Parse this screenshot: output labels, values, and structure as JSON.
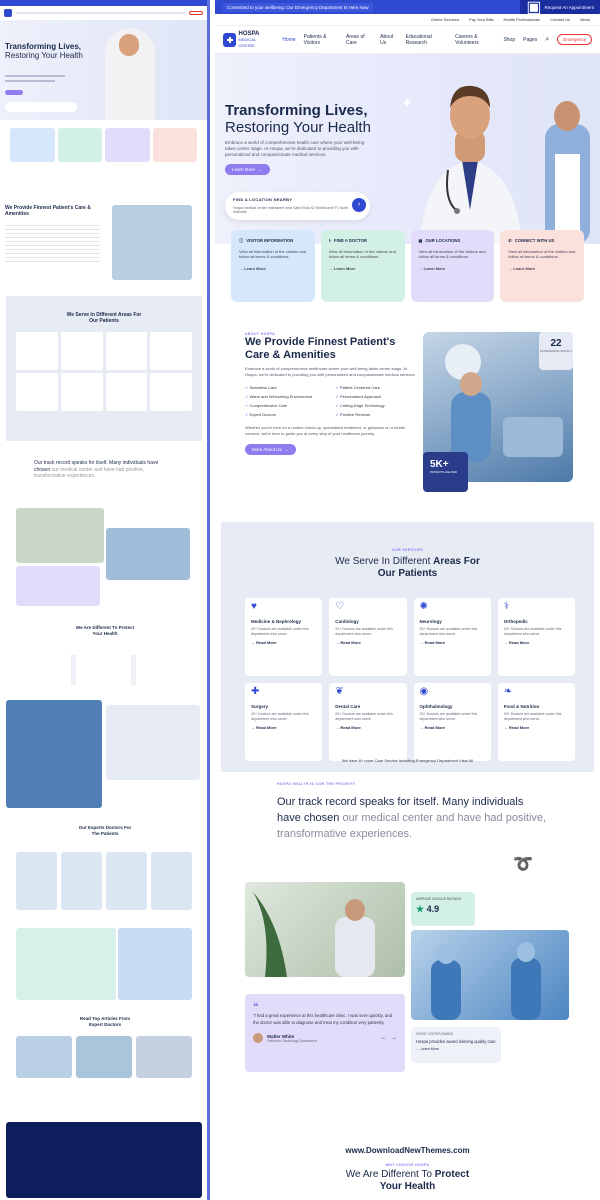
{
  "topbar": {
    "promo": "Committed to your wellbeing: Our Emergency Department Is Here Now",
    "links": [
      "Online Services",
      "Pay Your Bills",
      "Health Professionals",
      "Contact Us",
      "News"
    ],
    "appointment": "Request An Appointment"
  },
  "brand": {
    "name": "HOSPA",
    "sub1": "MEDICAL",
    "sub2": "CENTRE"
  },
  "nav": {
    "items": [
      "Home",
      "Patients & Visitors",
      "Areas of Care",
      "About Us",
      "Educational Research",
      "Careers & Volunteers",
      "Shop",
      "Pages"
    ],
    "emergency": "Emergency"
  },
  "hero": {
    "title1": "Transforming Lives,",
    "title2": "Restoring Your Health",
    "text": "Embrace a world of comprehensive health care where your well-being takes center stage. At Hospa, we're dedicated to providing you with personalized and compassionate medical services.",
    "button": "Learn More",
    "find_title": "FIND A LOCATION NEARBY",
    "find_value": "Hospa medical center mainstreet near Saint Kilda 52 Shelbourne Pl, North Adelaide"
  },
  "cards": [
    {
      "title": "VISITOR INFORMATION",
      "text": "View all information of the visitors and follow all terms & conditions.",
      "link": "Learn More",
      "color": "#d6e6fb"
    },
    {
      "title": "FIND A DOCTOR",
      "text": "View all information of the visitors and follow all terms & conditions.",
      "link": "Learn More",
      "color": "#d3f0e6"
    },
    {
      "title": "OUR LOCATIONS",
      "text": "View all information of the visitors and follow all terms & conditions.",
      "link": "Learn More",
      "color": "#e2dbfa"
    },
    {
      "title": "CONNECT WITH US",
      "text": "View all information of the visitors and follow all terms & conditions.",
      "link": "Learn More",
      "color": "#fbe1dc"
    }
  ],
  "about": {
    "kicker": "ABOUT HOSPA",
    "title1": "We Provide Finnest Patient's",
    "title2": "Care & Amenities",
    "text": "Embrace a world of comprehensive healthcare where your well-being takes center stage. At Hospa, we're dedicated to providing you with personalized and compassionate medical services.",
    "checks": [
      "Seamless Care",
      "Patient-Centered Care",
      "Warm and Welcoming Environment",
      "Personalized Approach",
      "Comprehensive Care",
      "Cutting-Edge Technology",
      "Expert Doctors",
      "Positive Reviews"
    ],
    "text2": "Whether you're here for a routine check-up, specialized treatment, or guidance on a health concern, we're here to guide you at every step of your healthcare journey.",
    "button": "More About Us",
    "years": "22",
    "years_label": "EXPERIENCE SINCE 3",
    "count": "5K+",
    "count_label": "PATIENTS HELPED"
  },
  "services": {
    "kicker": "OUR SERVICES",
    "title1": "We Serve In Different ",
    "title_bold": "Areas For",
    "title2": "Our Patients",
    "items": [
      {
        "name": "Medicine & Nephrology",
        "icon": "kidney-icon",
        "glyph": "♥"
      },
      {
        "name": "Cardiology",
        "icon": "heartbeat-icon",
        "glyph": "♡"
      },
      {
        "name": "Neurology",
        "icon": "brain-icon",
        "glyph": "✺"
      },
      {
        "name": "Orthopedic",
        "icon": "bone-icon",
        "glyph": "⚕"
      },
      {
        "name": "Surgery",
        "icon": "surgery-icon",
        "glyph": "✚"
      },
      {
        "name": "Dental Care",
        "icon": "tooth-icon",
        "glyph": "❦"
      },
      {
        "name": "Ophthalmology",
        "icon": "eye-icon",
        "glyph": "◉"
      },
      {
        "name": "Food & Nutrition",
        "icon": "nutrition-icon",
        "glyph": "❧"
      }
    ],
    "desc": "20+ Doctors are available under this department who serve.",
    "more": "Read More",
    "footer": "We have 8+ more Care Service including Emergency Department View All"
  },
  "track": {
    "kicker": "HOSPA HEALTH IS OUR THE PRIORITY",
    "q1": "Our track record speaks for itself. Many individuals have chosen ",
    "q2": "our medical center and have had positive, transformative experiences.",
    "rating_label": "AVERAGE GOOGLE RATINGS",
    "rating": "4.9",
    "review": "\"I had a great experience at this healthcare clinic. I was seen quickly, and the doctor was able to diagnose and treat my condition very patiently.",
    "reviewer": "Walter White",
    "reviewer_role": "Patient in Cardiology Department",
    "award_label": "GREAT CENTER AWARD",
    "award": "Hospa provides award winning quality care",
    "award_link": "Learn More"
  },
  "bottom": {
    "watermark": "www.DownloadNewThemes.com",
    "kicker": "WHY CHOOSE HOSPA",
    "title1": "We Are Different To ",
    "title_bold": "Protect",
    "title2": "Your Health"
  }
}
